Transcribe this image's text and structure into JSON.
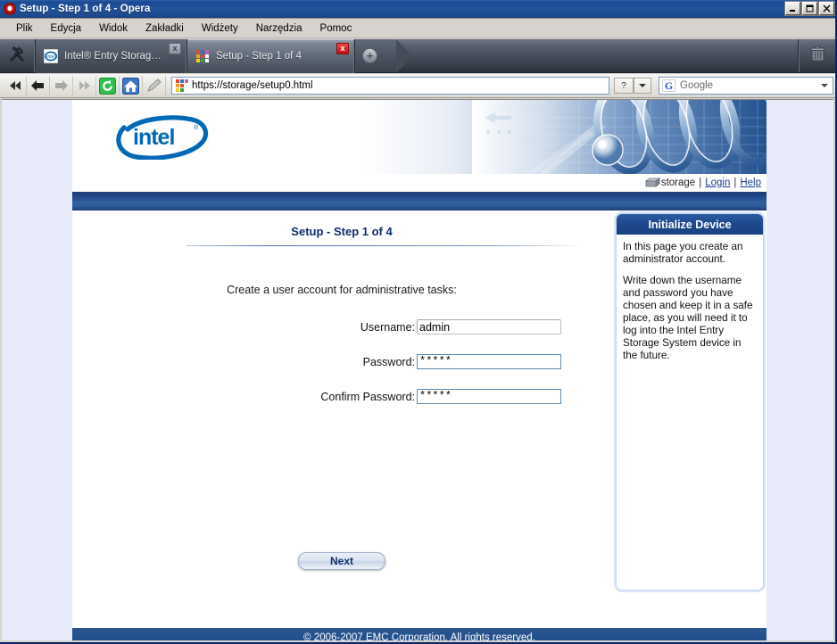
{
  "window": {
    "title": "Setup - Step 1 of 4 - Opera",
    "app_icon": "opera-logo-icon",
    "minimize_label": "_",
    "maximize_label": "□",
    "close_label": "×"
  },
  "menubar": {
    "items": [
      {
        "label": "Plik"
      },
      {
        "label": "Edycja"
      },
      {
        "label": "Widok"
      },
      {
        "label": "Zakładki"
      },
      {
        "label": "Widżety"
      },
      {
        "label": "Narzędzia"
      },
      {
        "label": "Pomoc"
      }
    ]
  },
  "tabbar": {
    "tools_icon": "wrench-screwdriver-icon",
    "trash_icon": "trash-icon",
    "new_tab_icon": "plus-circle-icon",
    "tabs": [
      {
        "label": "Intel® Entry Storage Sy...",
        "favicon": "intel-favicon",
        "active": false,
        "close_label": "x"
      },
      {
        "label": "Setup - Step 1 of 4",
        "favicon": "colored-squares-favicon",
        "active": true,
        "close_label": "x"
      }
    ]
  },
  "addressbar": {
    "buttons": [
      {
        "name": "rewind-button",
        "glyph": "«"
      },
      {
        "name": "back-button",
        "glyph": "←"
      },
      {
        "name": "forward-button",
        "glyph": "→"
      },
      {
        "name": "fast-forward-button",
        "glyph": "»"
      },
      {
        "name": "reload-button",
        "glyph": "↻"
      },
      {
        "name": "home-button",
        "glyph": "⌂"
      },
      {
        "name": "edit-button",
        "glyph": "✐"
      }
    ],
    "url": "https://storage/setup0.html",
    "url_favicon": "colored-squares-favicon",
    "help_button_label": "?",
    "search_engine": "Google",
    "search_engine_icon": "google-g-icon",
    "search_engine_letter": "G"
  },
  "banner": {
    "logo_text": "intel",
    "logo_trademark": "®",
    "storage_label": "storage",
    "storage_icon": "storage-device-icon",
    "separator": "|",
    "login_link": "Login",
    "help_link": "Help"
  },
  "main": {
    "step_title": "Setup - Step 1 of 4",
    "instruction": "Create a user account for administrative tasks:",
    "fields": [
      {
        "label": "Username:",
        "value": "admin",
        "type": "text",
        "name": "username-input"
      },
      {
        "label": "Password:",
        "value": "*****",
        "type": "password",
        "name": "password-input"
      },
      {
        "label": "Confirm Password:",
        "value": "*****",
        "type": "password",
        "name": "confirm-password-input"
      }
    ],
    "next_button": "Next"
  },
  "help_panel": {
    "title": "Initialize Device",
    "paragraphs": [
      "In this page you create an administrator account.",
      "Write down the username and password you have chosen and keep it in a safe place, as you will need it to log into the Intel Entry Storage System device in the future."
    ]
  },
  "footer": {
    "copyright": "© 2006-2007 EMC Corporation. All rights reserved."
  },
  "colors": {
    "titlebar_blue": "#1d4a8e",
    "intel_blue": "#0068b5",
    "panel_header_blue": "#1f4a8d",
    "footer_blue": "#24528f",
    "page_bg": "#e6eaf9",
    "link_blue": "#1a3c8c"
  }
}
